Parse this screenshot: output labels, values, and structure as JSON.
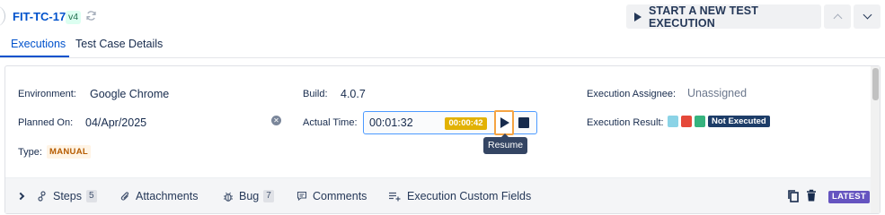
{
  "header": {
    "test_case_key": "FIT-TC-17",
    "version": "v4",
    "start_button_label": "START A NEW TEST EXECUTION"
  },
  "tabs": [
    {
      "label": "Executions",
      "active": true
    },
    {
      "label": "Test Case Details",
      "active": false
    }
  ],
  "details": {
    "environment_label": "Environment:",
    "environment_value": "Google Chrome",
    "build_label": "Build:",
    "build_value": "4.0.7",
    "assignee_label": "Execution Assignee:",
    "assignee_value": "Unassigned",
    "planned_label": "Planned On:",
    "planned_value": "04/Apr/2025",
    "actual_time_label": "Actual Time:",
    "actual_time_value": "00:01:32",
    "timer_value": "00:00:42",
    "tooltip": "Resume",
    "result_label": "Execution Result:",
    "result_status": "Not Executed",
    "result_colors": [
      "#8bd3e6",
      "#e5493a",
      "#36b37e"
    ],
    "type_label": "Type:",
    "type_value": "MANUAL"
  },
  "toolbar": {
    "steps_label": "Steps",
    "steps_count": "5",
    "attachments_label": "Attachments",
    "bug_label": "Bug",
    "bug_count": "7",
    "comments_label": "Comments",
    "custom_fields_label": "Execution Custom Fields",
    "latest_badge": "LATEST"
  }
}
